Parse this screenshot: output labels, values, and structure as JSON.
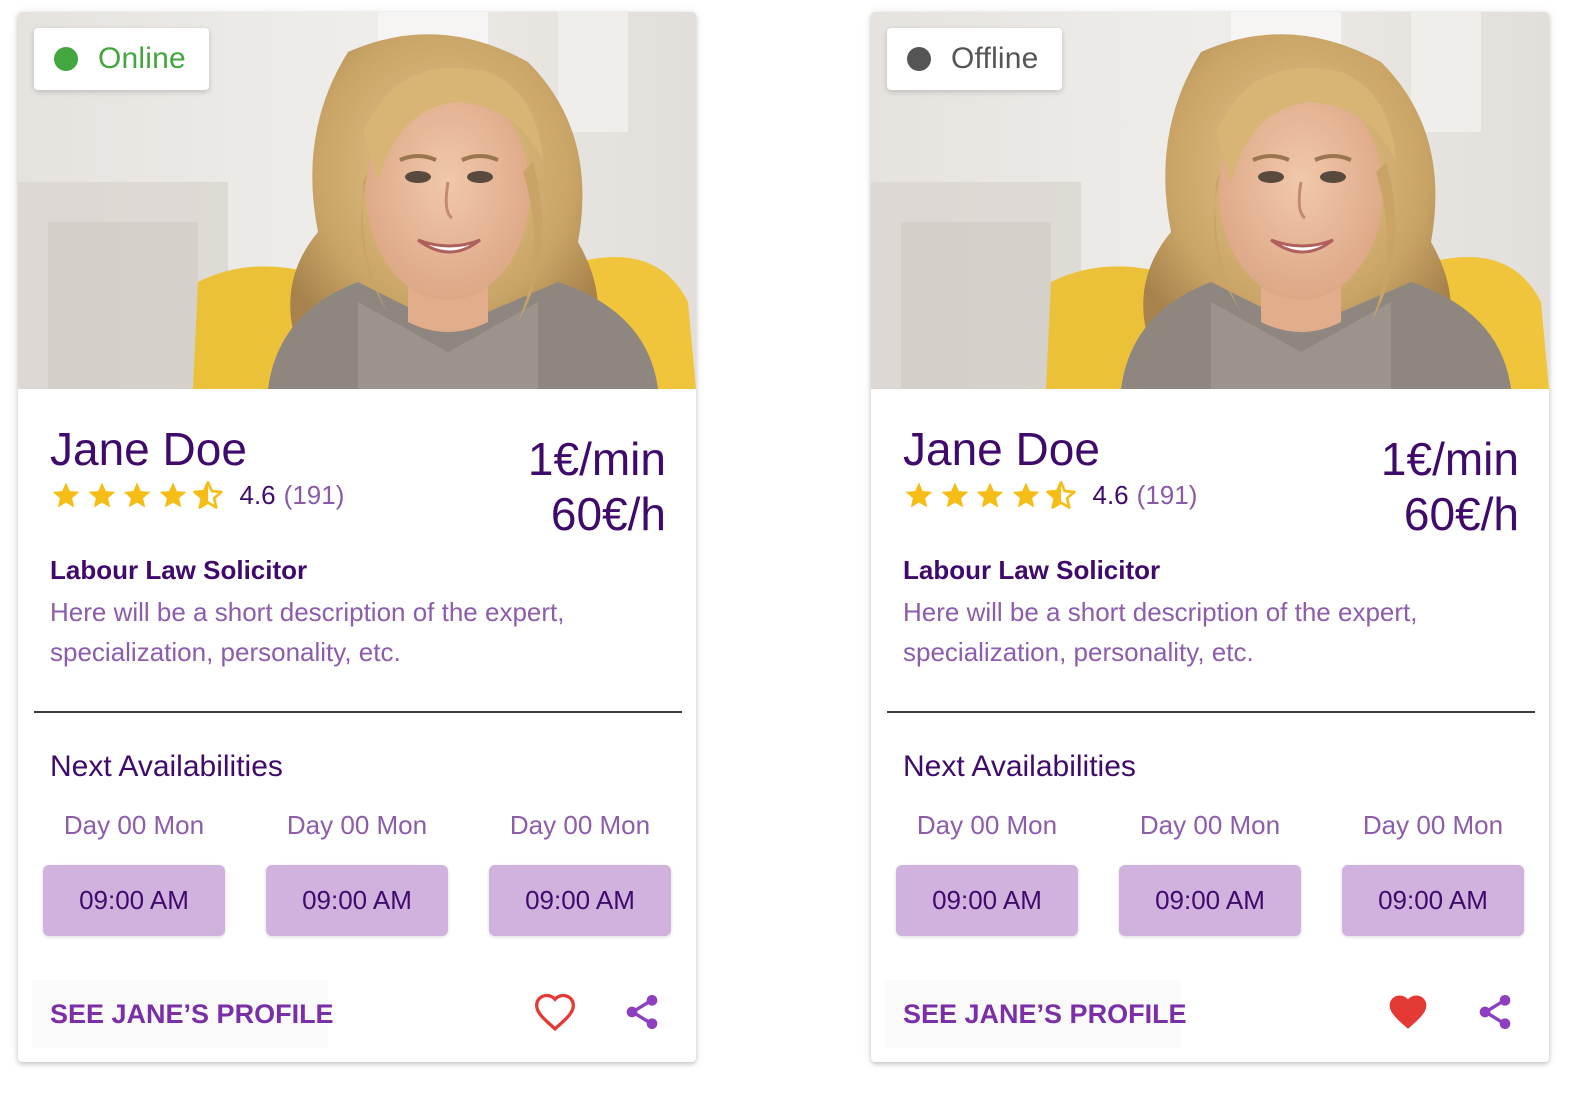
{
  "colors": {
    "primary_text": "#3f0a6b",
    "secondary_text": "#8d5cab",
    "slot_bg": "#d1b2df",
    "star": "#f6bd16",
    "heart": "#e53935",
    "share": "#8e3fbf",
    "online": "#43a63f",
    "offline": "#555555"
  },
  "cards": [
    {
      "status": {
        "label": "Online",
        "state": "online",
        "dot_color": "#43a63f",
        "text_color": "#43a63f"
      },
      "name": "Jane Doe",
      "rating": {
        "value": "4.6",
        "count": "(191)",
        "stars": 4.5
      },
      "price": {
        "per_minute": "1€/min",
        "per_hour": "60€/h"
      },
      "title": "Labour Law Solicitor",
      "description": "Here will be a short description of the expert, specialization, personality, etc.",
      "availability": {
        "heading": "Next Availabilities",
        "slots": [
          {
            "day": "Day 00 Mon",
            "time": "09:00 AM"
          },
          {
            "day": "Day 00 Mon",
            "time": "09:00 AM"
          },
          {
            "day": "Day 00 Mon",
            "time": "09:00 AM"
          }
        ]
      },
      "profile_button": "SEE JANE’S PROFILE",
      "favorite": {
        "icon": "heart-outline-icon",
        "active": false
      },
      "share": {
        "icon": "share-icon"
      }
    },
    {
      "status": {
        "label": "Offline",
        "state": "offline",
        "dot_color": "#555555",
        "text_color": "#555555"
      },
      "name": "Jane Doe",
      "rating": {
        "value": "4.6",
        "count": "(191)",
        "stars": 4.5
      },
      "price": {
        "per_minute": "1€/min",
        "per_hour": "60€/h"
      },
      "title": "Labour Law Solicitor",
      "description": "Here will be a short description of the expert, specialization, personality, etc.",
      "availability": {
        "heading": "Next Availabilities",
        "slots": [
          {
            "day": "Day 00 Mon",
            "time": "09:00 AM"
          },
          {
            "day": "Day 00 Mon",
            "time": "09:00 AM"
          },
          {
            "day": "Day 00 Mon",
            "time": "09:00 AM"
          }
        ]
      },
      "profile_button": "SEE JANE’S PROFILE",
      "favorite": {
        "icon": "heart-filled-icon",
        "active": true
      },
      "share": {
        "icon": "share-icon"
      }
    }
  ]
}
